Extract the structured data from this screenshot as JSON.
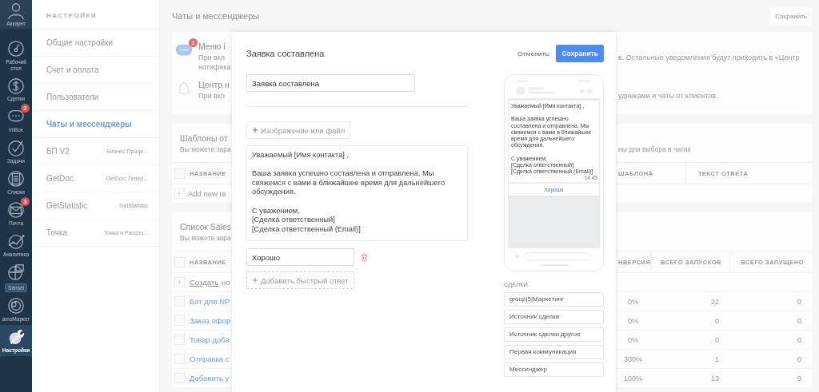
{
  "nav": {
    "items": [
      {
        "kind": "avatar",
        "label": "Аккаунт",
        "selected": false
      },
      {
        "kind": "dashboard",
        "label": "Рабочий стол",
        "selected": false
      },
      {
        "kind": "deals",
        "label": "Сделки",
        "selected": false
      },
      {
        "kind": "chat",
        "label": "imBox",
        "badge": "2",
        "selected": false
      },
      {
        "kind": "tasks",
        "label": "Задачи",
        "selected": false
      },
      {
        "kind": "lists",
        "label": "Списки",
        "selected": false
      },
      {
        "kind": "mail",
        "label": "Почта",
        "badge": "3",
        "selected": false
      },
      {
        "kind": "analytics",
        "label": "Аналитика",
        "selected": false
      },
      {
        "kind": "sensei",
        "chip": "Sensei",
        "selected": false
      },
      {
        "kind": "market",
        "label": "amoМаркет",
        "selected": false
      },
      {
        "kind": "settings",
        "label": "Настройки",
        "selected": true
      }
    ]
  },
  "settings_menu": {
    "title": "НАСТРОЙКИ",
    "items": [
      {
        "label": "Общие настройки",
        "selected": false
      },
      {
        "label": "Счет и оплата",
        "selected": false
      },
      {
        "label": "Пользователи",
        "selected": false
      },
      {
        "label": "Чаты и мессенджеры",
        "selected": true
      },
      {
        "label": "БП V2",
        "note": "Бизнес-Проце...",
        "selected": false
      },
      {
        "label": "GetDoc",
        "note": "GetDoc: Генер...",
        "selected": false
      },
      {
        "label": "GetStatistic",
        "note": "GetStatistic",
        "selected": false
      },
      {
        "label": "Точка",
        "note": "Точка и Рассро...",
        "selected": false
      }
    ]
  },
  "page": {
    "title": "Чаты и мессенджеры",
    "save_button": "Сохранить"
  },
  "notifications": [
    {
      "kind": "chat",
      "badge": "1",
      "title": "Меню i",
      "lines": [
        {
          "left": "При вкл",
          "right": "в. Остальные уведомления будут приходить в «Центр"
        },
        {
          "left": "нотифика"
        }
      ]
    },
    {
      "kind": "bell",
      "title": "Центр н",
      "lines": [
        {
          "left": "При вкл",
          "right": "удниками и чаты от клиентов."
        }
      ]
    }
  ],
  "tables": [
    {
      "kind": "templates",
      "title": "Шаблоны от",
      "subtitle_left": "Вы можете зара",
      "subtitle_right": "ны для выбора в чатах",
      "select_all_checked": false,
      "column_left": "НАЗВАНИЕ",
      "columns_right": [
        "ШАБЛОНА",
        "ТЕКСТ ОТВЕТА"
      ],
      "add_row": {
        "text": "Add new te"
      }
    },
    {
      "kind": "salesbots",
      "title": "Список Sales",
      "subtitle_left": "Вы можете зара",
      "select_all_checked": false,
      "column_left": "НАЗВАНИЕ",
      "columns_right": [
        "НВЕРСИЯ",
        "ВСЕГО ЗАПУСКОВ",
        "ВСЕГО ЗАПУЩЕНО"
      ],
      "add_row": {
        "link": "Создать",
        "text": "но"
      },
      "rows": [
        {
          "name": "Бот для NP",
          "checked": false,
          "cells": [
            "0%",
            "22",
            "0"
          ]
        },
        {
          "name": "Заказ офор",
          "checked": false,
          "cells": [
            "0%",
            "0",
            "0"
          ]
        },
        {
          "name": "Товар доба",
          "checked": false,
          "cells": [
            "0%",
            "0",
            "0"
          ]
        },
        {
          "name": "Отправка с",
          "checked": false,
          "cells": [
            "300%",
            "1",
            "0"
          ]
        },
        {
          "name": "Добавить у",
          "checked": false,
          "cells": [
            "100%",
            "13",
            "0"
          ]
        }
      ]
    }
  ],
  "modal": {
    "title": "Заявка составлена",
    "cancel": "Отменить",
    "save": "Сохранить",
    "name_value": "Заявка составлена",
    "attach_button": "Изображение или файл",
    "message": "Уважаемый [Имя контакта] ,\n\nВаша заявка успешно составлена и отправлена. Мы свяжемся с вами в ближайшее время для дальнейшего обсуждения.\n\nС уважением,\n[Сделка ответственный]\n[Сделка ответственный (Email)]",
    "quick_replies": [
      {
        "value": "Хорошо"
      }
    ],
    "add_reply_button": "Добавить быстрый ответ",
    "preview": {
      "message": "Уважаемый [Имя контакта] ,\n\nВаша заявка успешно составлена и отправлена. Мы свяжемся с вами в ближайшее время для дальнейшего обсуждения.\n\nС уважением,\n[Сделка ответственный]\n[Сделка ответственный (Email)]",
      "time": "14:45",
      "buttons": [
        "Хорошо"
      ]
    },
    "fields_title": "СДЕЛКИ",
    "fields": [
      "group|5|Маркетинг",
      "Источник сделки",
      "Источник сделки другое",
      "Первая коммуникация",
      "Мессенджер"
    ]
  }
}
